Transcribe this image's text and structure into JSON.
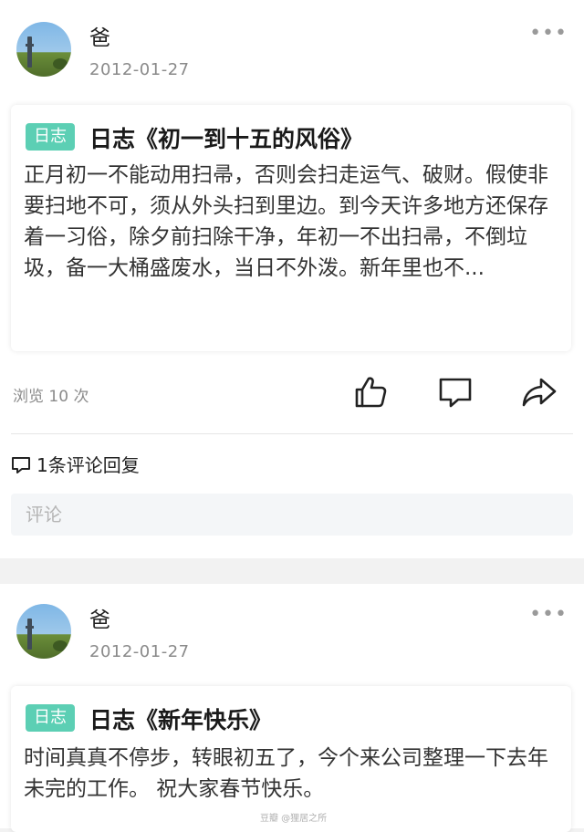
{
  "posts": [
    {
      "author": "爸",
      "date": "2012-01-27",
      "more": "•••",
      "tag": "日志",
      "title": "日志《初一到十五的风俗》",
      "body": "正月初一不能动用扫帚，否则会扫走运气、破财。假使非要扫地不可，须从外头扫到里边。到今天许多地方还保存着一习俗，除夕前扫除干净，年初一不出扫帚，不倒垃圾，备一大桶盛废水，当日不外泼。新年里也不...",
      "views": "浏览 10 次",
      "comment_count": "1条评论回复",
      "comment_placeholder": "评论"
    },
    {
      "author": "爸",
      "date": "2012-01-27",
      "more": "•••",
      "tag": "日志",
      "title": "日志《新年快乐》",
      "body": "时间真真不停步，转眼初五了，今个来公司整理一下去年未完的工作。 祝大家春节快乐。"
    }
  ],
  "icons": {
    "like": "thumbs-up-icon",
    "comment": "comment-icon",
    "share": "share-icon"
  },
  "watermark": "豆瓣 @狸居之所",
  "colors": {
    "tag_bg": "#5ccfb4",
    "muted_text": "#8a8a8a",
    "page_bg": "#f2f2f2"
  }
}
